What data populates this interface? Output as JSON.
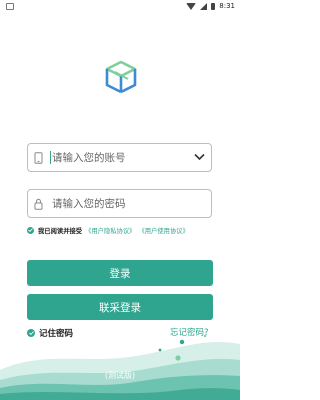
{
  "status_bar": {
    "time": "8:31"
  },
  "account": {
    "placeholder": "请输入您的账号",
    "value": ""
  },
  "password": {
    "placeholder": "请输入您的密码",
    "value": ""
  },
  "agreement": {
    "text": "我已阅读并接受",
    "privacy_link": "《用户隐私协议》",
    "usage_link": "《用户使用协议》",
    "checked": true
  },
  "buttons": {
    "login": "登录",
    "joint_login": "联采登录"
  },
  "remember": {
    "label": "记住密码",
    "checked": true
  },
  "forgot": "忘记密码?",
  "version": "(测试版)",
  "colors": {
    "accent": "#2fa58f",
    "logo_blue": "#3d8bd6",
    "logo_green": "#7fcf9c"
  },
  "icons": [
    "phone-icon",
    "lock-icon",
    "chevron-down-icon",
    "check-icon",
    "wifi-icon",
    "signal-icon",
    "battery-icon"
  ]
}
